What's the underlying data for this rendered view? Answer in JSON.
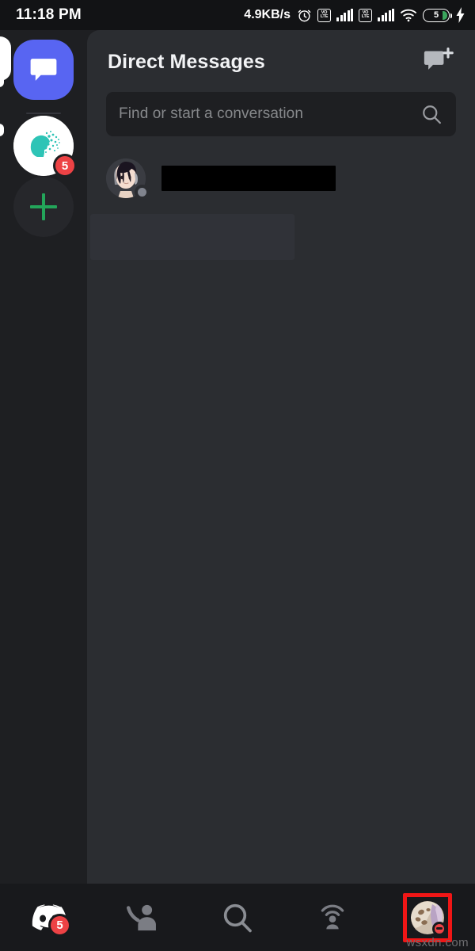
{
  "status_bar": {
    "clock": "11:18 PM",
    "network_speed": "4.9KB/s",
    "alarm_icon": "alarm-clock-icon",
    "volte_label_top": "VO",
    "volte_label_bottom": "LTE",
    "sim1_signal_icon": "signal-bars-icon",
    "sim2_signal_icon": "signal-bars-icon",
    "wifi_icon": "wifi-icon",
    "battery_level": "5",
    "charging_icon": "lightning-bolt-icon"
  },
  "server_rail": {
    "dm_button_label": "direct-messages-button",
    "dm_button_color": "#5865f2",
    "servers": [
      {
        "name": "server-avatar",
        "badge": "5",
        "badge_color": "#ed4245"
      }
    ],
    "add_server_label": "add-a-server-button",
    "add_server_accent": "#23a55a"
  },
  "main": {
    "header": {
      "title": "Direct Messages",
      "new_dm_icon": "new-message-icon"
    },
    "search": {
      "placeholder": "Find or start a conversation",
      "value": "",
      "icon": "search-icon"
    },
    "conversations": [
      {
        "name": "",
        "name_redacted": true,
        "presence": "offline",
        "presence_color": "#80848e",
        "avatar": "anime-character-avatar"
      }
    ],
    "redacted_block": true
  },
  "bottom_nav": {
    "items": [
      {
        "icon": "discord-logo-icon",
        "label": "servers",
        "badge": "5",
        "active": false
      },
      {
        "icon": "friends-icon",
        "label": "friends",
        "badge": "",
        "active": false
      },
      {
        "icon": "search-icon",
        "label": "search",
        "badge": "",
        "active": false
      },
      {
        "icon": "mentions-icon",
        "label": "mentions",
        "badge": "",
        "active": false
      },
      {
        "icon": "user-avatar-icon",
        "label": "you",
        "badge": "",
        "active": true
      }
    ],
    "highlight_color": "#f01616",
    "user_status": "dnd",
    "user_status_color": "#ed4245"
  },
  "watermark": "wsxdn.com"
}
